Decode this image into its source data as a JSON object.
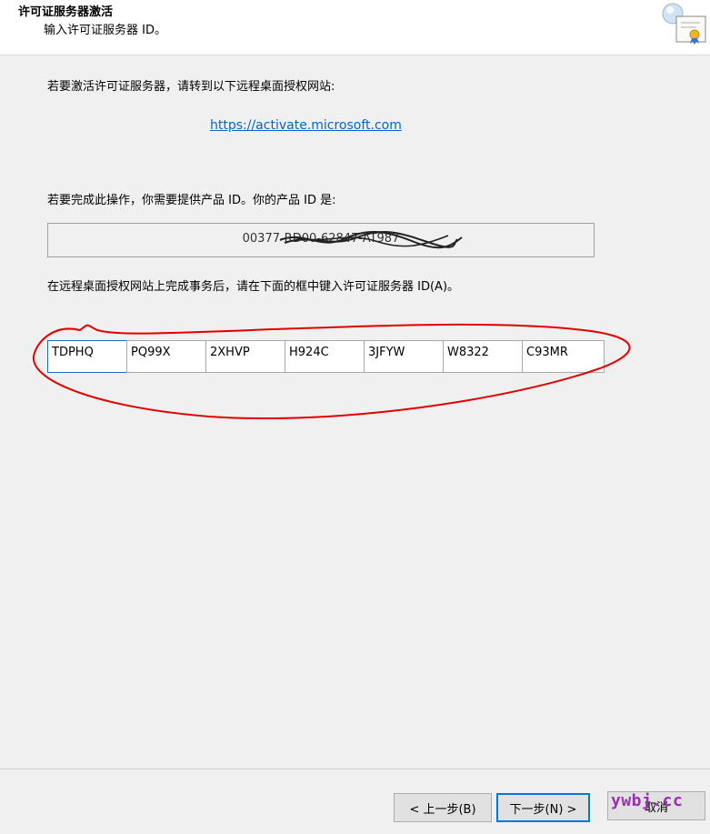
{
  "header": {
    "title": "许可证服务器激活",
    "subtitle": "输入许可证服务器 ID。",
    "icon": "certificate-icon"
  },
  "main": {
    "intro_text": "若要激活许可证服务器，请转到以下远程桌面授权网站:",
    "activation_link": "https://activate.microsoft.com",
    "product_id_label": "若要完成此操作，你需要提供产品 ID。你的产品 ID 是:",
    "product_id_value": "00377-RD00-62847-AT987",
    "instruction_text": "在远程桌面授权网站上完成事务后，请在下面的框中键入许可证服务器 ID(A)。",
    "server_id_fields": [
      "TDPHQ",
      "PQ99X",
      "2XHVP",
      "H924C",
      "3JFYW",
      "W8322",
      "C93MR"
    ]
  },
  "footer": {
    "back_label": "< 上一步(B)",
    "next_label": "下一步(N) >",
    "cancel_label": "取消"
  },
  "watermark": "ywbj.cc",
  "colors": {
    "annotation": "#e00000",
    "link": "#0066cc",
    "watermark": "#9b2fb3"
  }
}
